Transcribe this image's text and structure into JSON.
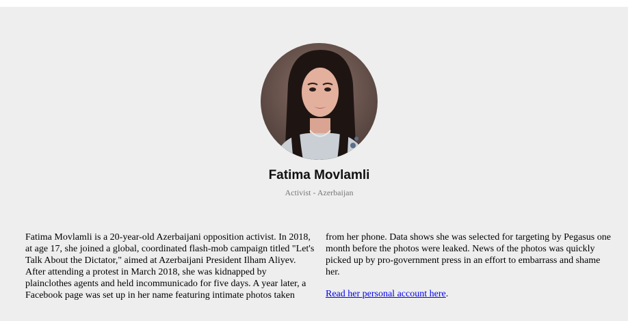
{
  "profile": {
    "name": "Fatima Movlamli",
    "subtitle": "Activist - Azerbaijan",
    "avatar_icon": "profile-photo"
  },
  "bio": {
    "paragraph": "Fatima Movlamli is a 20-year-old Azerbaijani opposition activist. In 2018, at age 17, she joined a global, coordinated flash-mob campaign titled \"Let's Talk About the Dictator,\" aimed at Azerbaijani President Ilham Aliyev. After attending a protest in March 2018, she was kidnapped by plainclothes agents and held incommunicado for five days. A year later, a Facebook page was set up in her name featuring intimate photos taken from her phone. Data shows she was selected for targeting by Pegasus one month before the photos were leaked. News of the photos was quickly picked up by pro-government press in an effort to embarrass and shame her.",
    "link_text": "Read her personal account here",
    "link_suffix": "."
  },
  "colors": {
    "panel_background": "#eeeeee",
    "link": "#0000ee",
    "subtitle": "#777777"
  }
}
